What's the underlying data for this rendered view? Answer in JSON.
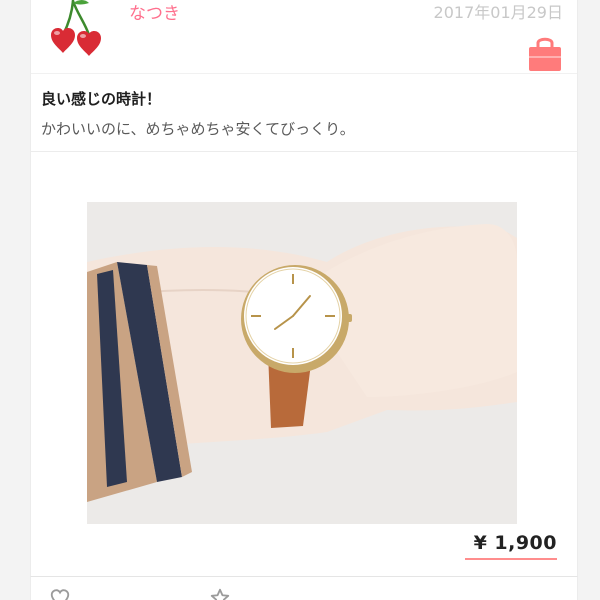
{
  "post": {
    "user": {
      "name": "なつき",
      "avatar": "cherry-icon"
    },
    "date": "2017年01月29日",
    "title": "良い感じの時計！",
    "body": "かわいいのに、めちゃめちゃ安くてびっくり。",
    "image": {
      "subject": "watch-on-wrist-photo"
    },
    "price": "¥ 1,900",
    "purchase_icon": "shopping-bag-icon"
  },
  "actions": [
    {
      "icon": "heart-icon"
    },
    {
      "icon": "star-icon"
    }
  ],
  "colors": {
    "accent_pink": "#ff6f8d",
    "date_gray": "#c8c8c8",
    "price_underline": "#ff8d8d",
    "bag_color": "#ff7b7b"
  }
}
